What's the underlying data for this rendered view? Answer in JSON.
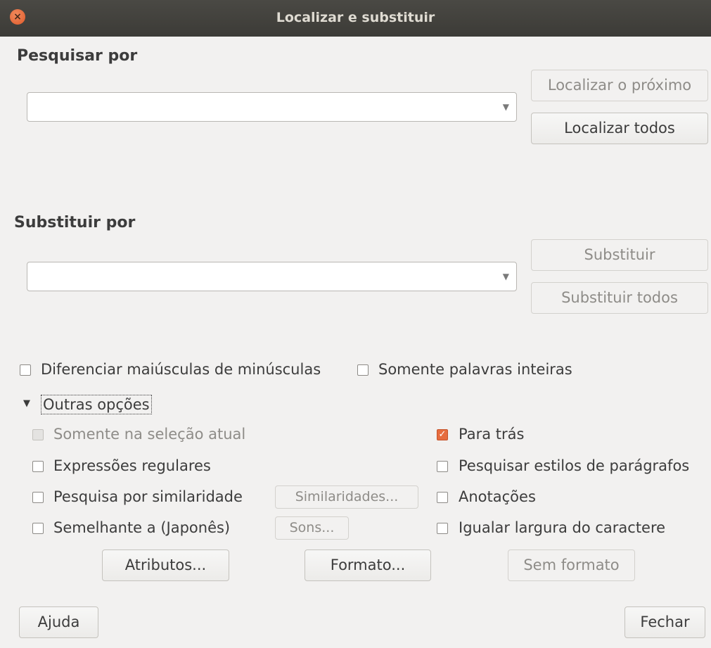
{
  "window": {
    "title": "Localizar e substituir",
    "close_icon": "close-icon"
  },
  "search": {
    "label": "Pesquisar por",
    "value": "",
    "find_next_label": "Localizar o próximo",
    "find_all_label": "Localizar todos"
  },
  "replace": {
    "label": "Substituir por",
    "value": "",
    "replace_label": "Substituir",
    "replace_all_label": "Substituir todos"
  },
  "options": {
    "match_case": {
      "label": "Diferenciar maiúsculas de minúsculas",
      "checked": false
    },
    "whole_words": {
      "label": "Somente palavras inteiras",
      "checked": false
    }
  },
  "other_options": {
    "expander_label": "Outras opções",
    "expanded": true,
    "current_selection": {
      "label": "Somente na seleção atual",
      "checked": false,
      "disabled": true
    },
    "regex": {
      "label": "Expressões regulares",
      "checked": false
    },
    "similarity": {
      "label": "Pesquisa por similaridade",
      "checked": false
    },
    "similarities_button": "Similaridades...",
    "japanese": {
      "label": "Semelhante a (Japonês)",
      "checked": false
    },
    "sounds_button": "Sons...",
    "backwards": {
      "label": "Para trás",
      "checked": true
    },
    "paragraph_styles": {
      "label": "Pesquisar estilos de parágrafos",
      "checked": false
    },
    "comments": {
      "label": "Anotações",
      "checked": false
    },
    "char_width": {
      "label": "Igualar largura do caractere",
      "checked": false
    },
    "attributes_button": "Atributos...",
    "format_button": "Formato...",
    "no_format_button": "Sem formato"
  },
  "footer": {
    "help_label": "Ajuda",
    "close_label": "Fechar"
  },
  "colors": {
    "accent": "#e66c3e",
    "titlebar": "#3c3b37",
    "background": "#f2f1f0"
  }
}
